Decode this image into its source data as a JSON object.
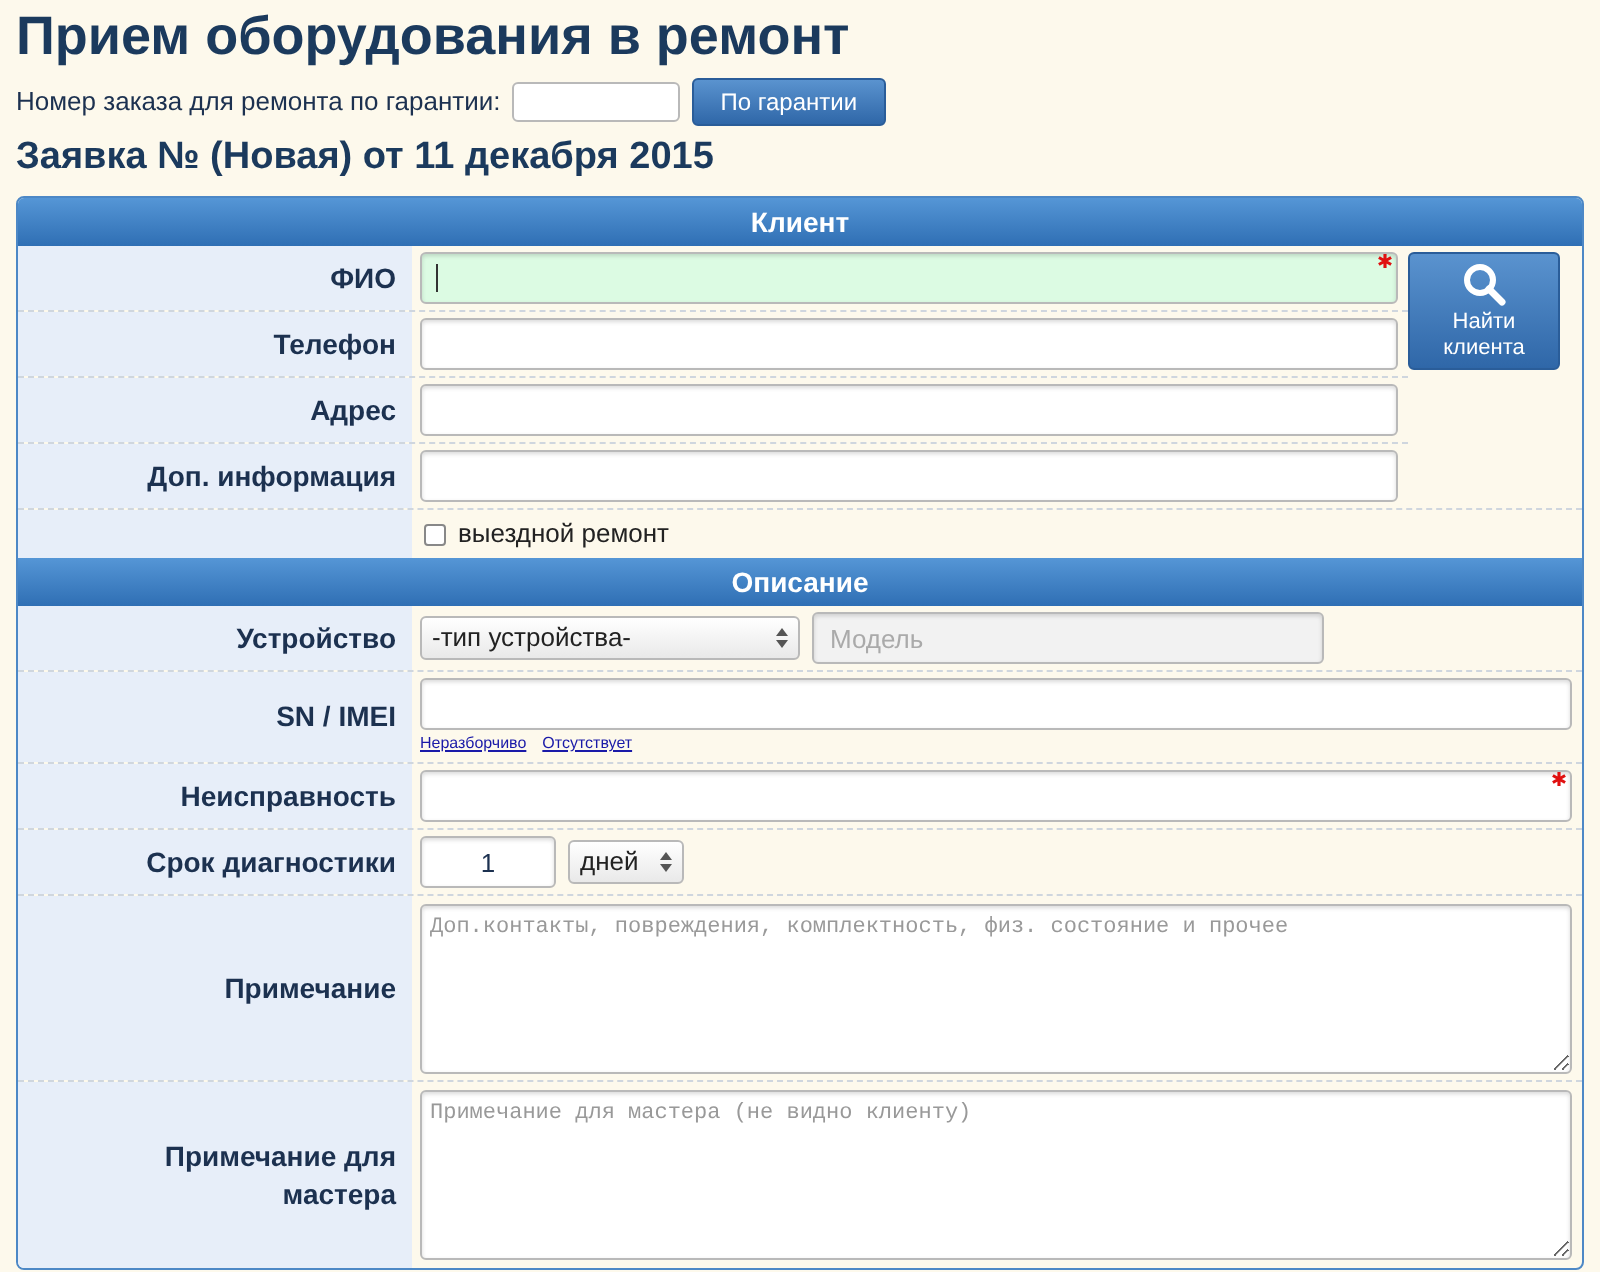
{
  "title": "Прием оборудования в ремонт",
  "warranty": {
    "label": "Номер заказа для ремонта по гарантии:",
    "button": "По гарантии"
  },
  "subtitle": "Заявка № (Новая) от 11 декабря 2015",
  "client": {
    "title": "Клиент",
    "rows": [
      {
        "label": "ФИО",
        "required": true,
        "focused": true
      },
      {
        "label": "Телефон",
        "required": false,
        "focused": false
      },
      {
        "label": "Адрес",
        "required": false,
        "focused": false
      },
      {
        "label": "Доп. информация",
        "required": false,
        "focused": false
      }
    ],
    "find_button": "Найти клиента",
    "checkbox": {
      "label": "выездной ремонт",
      "checked": false
    }
  },
  "description": {
    "title": "Описание",
    "rows": [
      {
        "kind": "device",
        "label": "Устройство",
        "select": "-тип устройства-",
        "placeholder": "Модель"
      },
      {
        "kind": "serial",
        "label": "SN / IMEI",
        "links": [
          "Неразборчиво",
          "Отсутствует"
        ]
      },
      {
        "kind": "text",
        "label": "Неисправность",
        "required": true
      },
      {
        "kind": "term",
        "label": "Срок диагностики",
        "value": "1",
        "unit": "дней"
      },
      {
        "kind": "note",
        "label": "Примечание",
        "placeholder": "Доп.контакты, повреждения, комплектность, физ. состояние и прочее"
      },
      {
        "kind": "note",
        "label": "Примечание для мастера",
        "placeholder": "Примечание для мастера (не видно клиенту)"
      }
    ]
  }
}
